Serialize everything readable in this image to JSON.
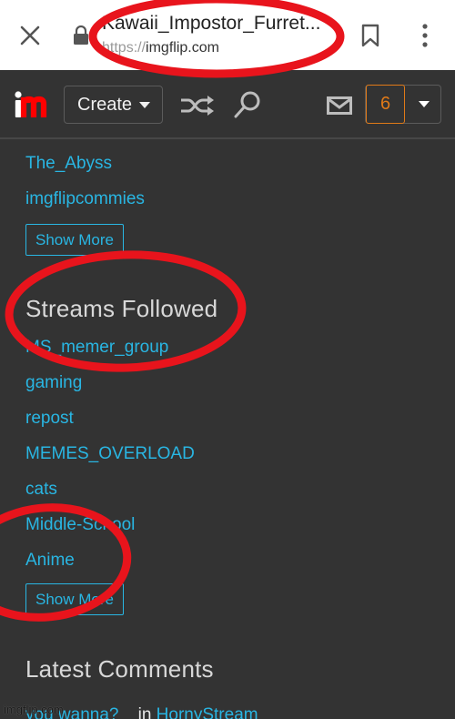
{
  "browser": {
    "page_title": "Kawaii_Impostor_Furret...",
    "url_scheme": "https://",
    "url_host": "imgflip.com",
    "icons": {
      "close": "close-icon",
      "lock": "lock-icon",
      "bookmark": "bookmark-icon",
      "menu": "more-vert-icon"
    }
  },
  "navbar": {
    "logo_text": "im",
    "create_label": "Create",
    "notification_count": "6",
    "icons": {
      "shuffle": "shuffle-icon",
      "search": "search-icon",
      "mail": "mail-icon",
      "dropdown": "caret-down-icon"
    },
    "colors": {
      "logo_i": "#ffffff",
      "logo_m": "#ff0000",
      "notification": "#e07a18"
    }
  },
  "groups_list": {
    "items": [
      "The_Abyss",
      "imgflipcommies"
    ],
    "show_more_label": "Show More"
  },
  "streams_followed": {
    "title": "Streams Followed",
    "items": [
      "MS_memer_group",
      "gaming",
      "repost",
      "MEMES_OVERLOAD",
      "cats",
      "Middle-School",
      "Anime"
    ],
    "show_more_label": "Show More"
  },
  "latest_comments": {
    "title": "Latest Comments",
    "items": [
      {
        "text": "you wanna?",
        "in_label": "in",
        "stream": "HornyStream"
      }
    ]
  },
  "watermark": "imgflip.com",
  "colors": {
    "background": "#333333",
    "link": "#29b6e3",
    "annotation": "#e8141c"
  }
}
